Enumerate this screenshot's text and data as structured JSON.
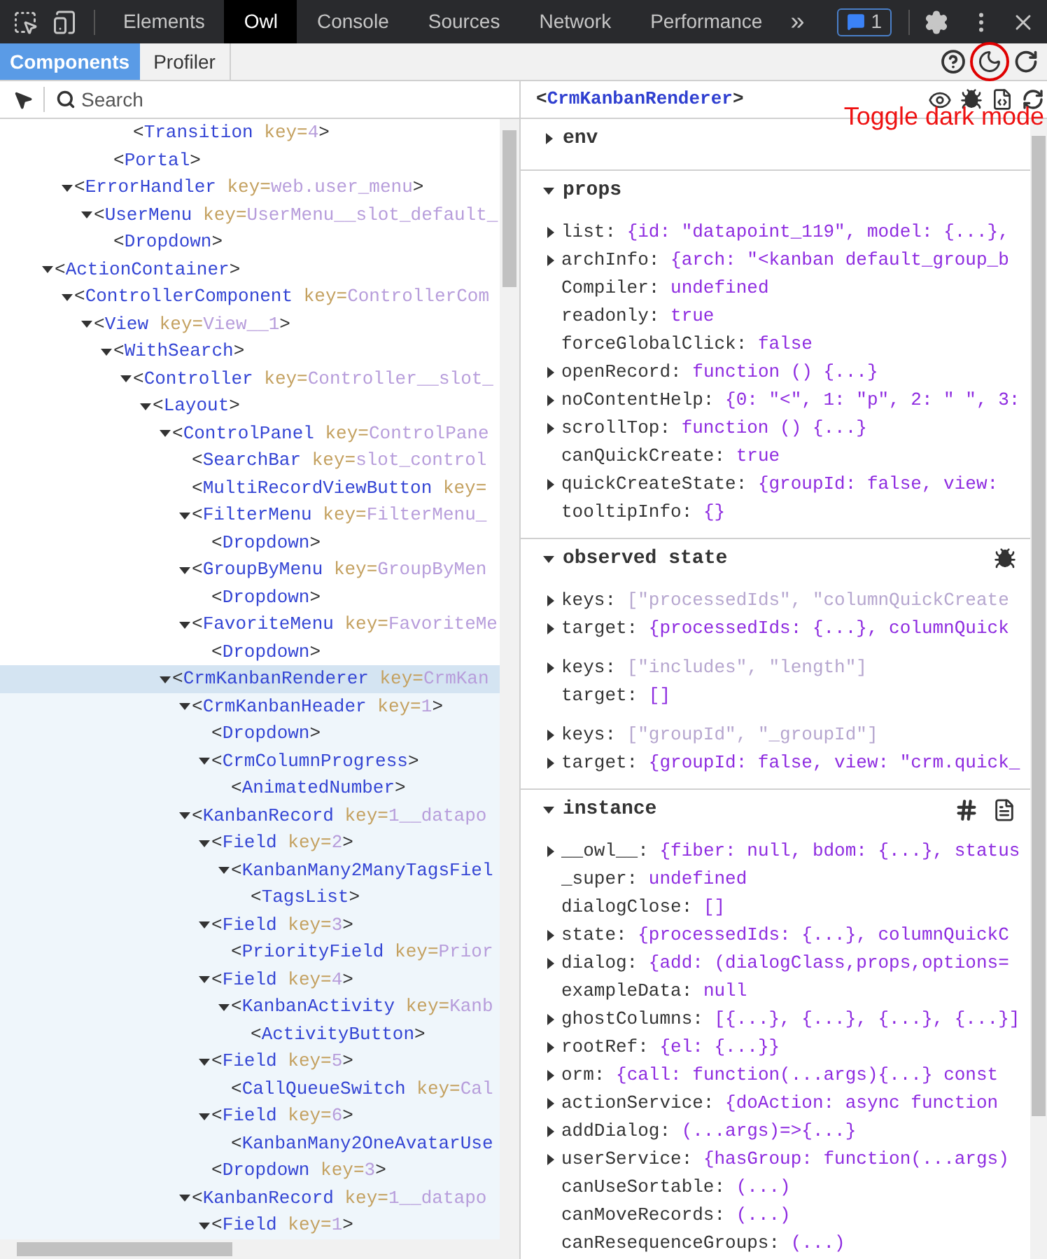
{
  "devtools_tabs": [
    {
      "label": "Elements",
      "selected": false
    },
    {
      "label": "Owl",
      "selected": true
    },
    {
      "label": "Console",
      "selected": false
    },
    {
      "label": "Sources",
      "selected": false
    },
    {
      "label": "Network",
      "selected": false
    },
    {
      "label": "Performance",
      "selected": false
    }
  ],
  "more_tabs": "»",
  "message_count": "1",
  "owl_tabs": [
    {
      "label": "Components",
      "selected": true
    },
    {
      "label": "Profiler",
      "selected": false
    }
  ],
  "search": {
    "placeholder": "Search"
  },
  "annotation": {
    "text": "Toggle dark mode"
  },
  "tree": [
    {
      "children": [
        {
          "children": [
            {
              "children": [
                {
                  "children": [
                    {
                      "tag": "<Transition",
                      "attr": "key=",
                      "value": "4",
                      "end": ">",
                      "expanded": false,
                      "selected": false
                    }
                  ]
                },
                {
                  "tag": "<Portal",
                  "end": ">",
                  "expanded": false,
                  "selected": false
                }
              ]
            }
          ]
        },
        {
          "tag": "<ErrorHandler",
          "attr": "key=",
          "value": "web.user_menu",
          "end": ">",
          "expanded": true,
          "selected": false,
          "children": [
            {
              "tag": "<UserMenu",
              "attr": "key=",
              "value": "UserMenu__slot_default_",
              "expanded": true,
              "selected": false,
              "children": [
                {
                  "tag": "<Dropdown",
                  "end": ">",
                  "expanded": false,
                  "selected": false
                }
              ]
            }
          ]
        }
      ]
    },
    {
      "tag": "<ActionContainer",
      "end": ">",
      "expanded": true,
      "selected": false,
      "children": [
        {
          "tag": "<ControllerComponent",
          "attr": "key=",
          "value": "ControllerCom",
          "expanded": true,
          "selected": false,
          "children": [
            {
              "tag": "<View",
              "attr": "key=",
              "value": "View__1",
              "end": ">",
              "expanded": true,
              "selected": false,
              "children": [
                {
                  "tag": "<WithSearch",
                  "end": ">",
                  "expanded": true,
                  "selected": false,
                  "children": [
                    {
                      "tag": "<Controller",
                      "attr": "key=",
                      "value": "Controller__slot_",
                      "expanded": true,
                      "selected": false,
                      "children": [
                        {
                          "tag": "<Layout",
                          "end": ">",
                          "expanded": true,
                          "selected": false,
                          "children": [
                            {
                              "tag": "<ControlPanel",
                              "attr": "key=",
                              "value": "ControlPane",
                              "expanded": true,
                              "selected": false,
                              "children": [
                                {
                                  "tag": "<SearchBar",
                                  "attr": "key=",
                                  "value": "slot_control",
                                  "expanded": false,
                                  "selected": false
                                },
                                {
                                  "tag": "<MultiRecordViewButton",
                                  "attr": "key=",
                                  "expanded": false,
                                  "selected": false
                                },
                                {
                                  "tag": "<FilterMenu",
                                  "attr": "key=",
                                  "value": "FilterMenu_",
                                  "expanded": true,
                                  "selected": false,
                                  "children": [
                                    {
                                      "tag": "<Dropdown",
                                      "end": ">",
                                      "expanded": false,
                                      "selected": false
                                    }
                                  ]
                                },
                                {
                                  "tag": "<GroupByMenu",
                                  "attr": "key=",
                                  "value": "GroupByMen",
                                  "expanded": true,
                                  "selected": false,
                                  "children": [
                                    {
                                      "tag": "<Dropdown",
                                      "end": ">",
                                      "expanded": false,
                                      "selected": false
                                    }
                                  ]
                                },
                                {
                                  "tag": "<FavoriteMenu",
                                  "attr": "key=",
                                  "value": "FavoriteMe",
                                  "expanded": true,
                                  "selected": false,
                                  "children": [
                                    {
                                      "tag": "<Dropdown",
                                      "end": ">",
                                      "expanded": false,
                                      "selected": false
                                    }
                                  ]
                                }
                              ]
                            },
                            {
                              "tag": "<CrmKanbanRenderer",
                              "attr": "key=",
                              "value": "CrmKan",
                              "expanded": true,
                              "selected": true,
                              "children": [
                                {
                                  "tag": "<CrmKanbanHeader",
                                  "attr": "key=",
                                  "value": "1",
                                  "end": ">",
                                  "expanded": true,
                                  "selected": false,
                                  "children": [
                                    {
                                      "tag": "<Dropdown",
                                      "end": ">",
                                      "expanded": false,
                                      "selected": false
                                    },
                                    {
                                      "tag": "<CrmColumnProgress",
                                      "end": ">",
                                      "expanded": true,
                                      "selected": false,
                                      "children": [
                                        {
                                          "tag": "<AnimatedNumber",
                                          "end": ">",
                                          "expanded": false,
                                          "selected": false
                                        }
                                      ]
                                    }
                                  ]
                                },
                                {
                                  "tag": "<KanbanRecord",
                                  "attr": "key=",
                                  "value": "1__datapo",
                                  "expanded": true,
                                  "selected": false,
                                  "children": [
                                    {
                                      "tag": "<Field",
                                      "attr": "key=",
                                      "value": "2",
                                      "end": ">",
                                      "expanded": true,
                                      "selected": false,
                                      "children": [
                                        {
                                          "tag": "<KanbanMany2ManyTagsFiel",
                                          "expanded": true,
                                          "selected": false,
                                          "children": [
                                            {
                                              "tag": "<TagsList",
                                              "end": ">",
                                              "expanded": false,
                                              "selected": false
                                            }
                                          ]
                                        }
                                      ]
                                    },
                                    {
                                      "tag": "<Field",
                                      "attr": "key=",
                                      "value": "3",
                                      "end": ">",
                                      "expanded": true,
                                      "selected": false,
                                      "children": [
                                        {
                                          "tag": "<PriorityField",
                                          "attr": "key=",
                                          "value": "Prior",
                                          "expanded": false,
                                          "selected": false
                                        }
                                      ]
                                    },
                                    {
                                      "tag": "<Field",
                                      "attr": "key=",
                                      "value": "4",
                                      "end": ">",
                                      "expanded": true,
                                      "selected": false,
                                      "children": [
                                        {
                                          "tag": "<KanbanActivity",
                                          "attr": "key=",
                                          "value": "Kanb",
                                          "expanded": true,
                                          "selected": false,
                                          "children": [
                                            {
                                              "tag": "<ActivityButton",
                                              "end": ">",
                                              "expanded": false,
                                              "selected": false
                                            }
                                          ]
                                        }
                                      ]
                                    },
                                    {
                                      "tag": "<Field",
                                      "attr": "key=",
                                      "value": "5",
                                      "end": ">",
                                      "expanded": true,
                                      "selected": false,
                                      "children": [
                                        {
                                          "tag": "<CallQueueSwitch",
                                          "attr": "key=",
                                          "value": "Cal",
                                          "expanded": false,
                                          "selected": false
                                        }
                                      ]
                                    },
                                    {
                                      "tag": "<Field",
                                      "attr": "key=",
                                      "value": "6",
                                      "end": ">",
                                      "expanded": true,
                                      "selected": false,
                                      "children": [
                                        {
                                          "tag": "<KanbanMany2OneAvatarUse",
                                          "expanded": false,
                                          "selected": false
                                        }
                                      ]
                                    },
                                    {
                                      "tag": "<Dropdown",
                                      "attr": "key=",
                                      "value": "3",
                                      "end": ">",
                                      "expanded": false,
                                      "selected": false
                                    }
                                  ]
                                },
                                {
                                  "tag": "<KanbanRecord",
                                  "attr": "key=",
                                  "value": "1__datapo",
                                  "expanded": true,
                                  "selected": false,
                                  "children": [
                                    {
                                      "tag": "<Field",
                                      "attr": "key=",
                                      "value": "1",
                                      "end": ">",
                                      "expanded": true,
                                      "selected": false
                                    }
                                  ]
                                }
                              ]
                            }
                          ]
                        }
                      ]
                    }
                  ]
                }
              ]
            }
          ]
        }
      ]
    }
  ],
  "details": {
    "title": "<CrmKanbanRenderer>",
    "sections": [
      {
        "kind": "env",
        "title": "env",
        "expanded": false
      },
      {
        "kind": "props",
        "title": "props",
        "expanded": true,
        "groups": [
          [
            {
              "key": "list:",
              "value": "{id: \"datapoint_119\", model: {...},",
              "expandable": true,
              "dimmed": false
            },
            {
              "key": "archInfo:",
              "value": "{arch: \"<kanban default_group_b",
              "expandable": true,
              "dimmed": false
            },
            {
              "key": "Compiler:",
              "value": "undefined",
              "expandable": false,
              "dimmed": false
            },
            {
              "key": "readonly:",
              "value": "true",
              "expandable": false,
              "dimmed": false
            },
            {
              "key": "forceGlobalClick:",
              "value": "false",
              "expandable": false,
              "dimmed": false
            },
            {
              "key": "openRecord:",
              "value": "function () {...}",
              "expandable": true,
              "dimmed": false
            },
            {
              "key": "noContentHelp:",
              "value": "{0: \"<\", 1: \"p\", 2: \" \", 3:",
              "expandable": true,
              "dimmed": false
            },
            {
              "key": "scrollTop:",
              "value": "function () {...}",
              "expandable": true,
              "dimmed": false
            },
            {
              "key": "canQuickCreate:",
              "value": "true",
              "expandable": false,
              "dimmed": false
            },
            {
              "key": "quickCreateState:",
              "value": "{groupId: false, view:",
              "expandable": true,
              "dimmed": false
            },
            {
              "key": "tooltipInfo:",
              "value": "{}",
              "expandable": false,
              "dimmed": false
            }
          ]
        ]
      },
      {
        "kind": "observed",
        "title": "observed state",
        "expanded": true,
        "groups": [
          [
            {
              "key": "keys:",
              "value": "[\"processedIds\", \"columnQuickCreate",
              "expandable": true,
              "dimmed": true
            },
            {
              "key": "target:",
              "value": "{processedIds: {...}, columnQuick",
              "expandable": true,
              "dimmed": false
            }
          ],
          [
            {
              "key": "keys:",
              "value": "[\"includes\", \"length\"]",
              "expandable": true,
              "dimmed": true
            },
            {
              "key": "target:",
              "value": "[]",
              "expandable": false,
              "dimmed": false
            }
          ],
          [
            {
              "key": "keys:",
              "value": "[\"groupId\", \"_groupId\"]",
              "expandable": true,
              "dimmed": true
            },
            {
              "key": "target:",
              "value": "{groupId: false, view: \"crm.quick_",
              "expandable": true,
              "dimmed": false
            }
          ]
        ]
      },
      {
        "kind": "instance",
        "title": "instance",
        "expanded": true,
        "groups": [
          [
            {
              "key": "__owl__:",
              "value": "{fiber: null, bdom: {...}, status",
              "expandable": true,
              "dimmed": false
            },
            {
              "key": "_super:",
              "value": "undefined",
              "expandable": false,
              "dimmed": false
            },
            {
              "key": "dialogClose:",
              "value": "[]",
              "expandable": false,
              "dimmed": false
            },
            {
              "key": "state:",
              "value": "{processedIds: {...}, columnQuickC",
              "expandable": true,
              "dimmed": false
            },
            {
              "key": "dialog:",
              "value": "{add: (dialogClass,props,options=",
              "expandable": true,
              "dimmed": false
            },
            {
              "key": "exampleData:",
              "value": "null",
              "expandable": false,
              "dimmed": false
            },
            {
              "key": "ghostColumns:",
              "value": "[{...}, {...}, {...}, {...}]",
              "expandable": true,
              "dimmed": false
            },
            {
              "key": "rootRef:",
              "value": "{el: {...}}",
              "expandable": true,
              "dimmed": false
            },
            {
              "key": "orm:",
              "value": "{call: function(...args){...} const",
              "expandable": true,
              "dimmed": false
            },
            {
              "key": "actionService:",
              "value": "{doAction: async function",
              "expandable": true,
              "dimmed": false
            },
            {
              "key": "addDialog:",
              "value": "(...args)=>{...}",
              "expandable": true,
              "dimmed": false
            },
            {
              "key": "userService:",
              "value": "{hasGroup: function(...args)",
              "expandable": true,
              "dimmed": false
            },
            {
              "key": "canUseSortable:",
              "value": "(...)",
              "expandable": false,
              "dimmed": false
            },
            {
              "key": "canMoveRecords:",
              "value": "(...)",
              "expandable": false,
              "dimmed": false
            },
            {
              "key": "canResequenceGroups:",
              "value": "(...)",
              "expandable": false,
              "dimmed": false
            }
          ]
        ]
      }
    ]
  }
}
